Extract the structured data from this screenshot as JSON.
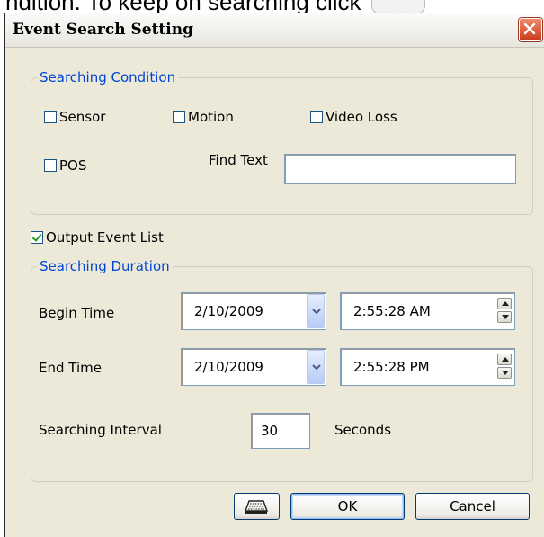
{
  "background_text": {
    "line": "ndition. To keep on searching click"
  },
  "dialog": {
    "title": "Event Search Setting"
  },
  "searching_condition": {
    "legend": "Searching Condition",
    "sensor": {
      "label": "Sensor",
      "checked": false
    },
    "motion": {
      "label": "Motion",
      "checked": false
    },
    "video_loss": {
      "label": "Video Loss",
      "checked": false
    },
    "pos": {
      "label": "POS",
      "checked": false
    },
    "find_text": {
      "label": "Find Text",
      "value": ""
    }
  },
  "output_event_list": {
    "label": "Output Event List",
    "checked": true
  },
  "searching_duration": {
    "legend": "Searching Duration",
    "begin": {
      "label": "Begin Time",
      "date": "2/10/2009",
      "time": "2:55:28 AM"
    },
    "end": {
      "label": "End Time",
      "date": "2/10/2009",
      "time": "2:55:28 PM"
    },
    "interval": {
      "label": "Searching Interval",
      "value": "30",
      "unit": "Seconds"
    }
  },
  "buttons": {
    "ok": "OK",
    "cancel": "Cancel"
  },
  "colors": {
    "legend": "#0046d5",
    "dialog_bg": "#ece9d8",
    "check_mark": "#21a121",
    "close_button": "#c93a1c"
  },
  "icons": {
    "close": "close-icon",
    "keyboard": "keyboard-icon",
    "dropdown": "chevron-down-icon",
    "spin_up": "spin-up-icon",
    "spin_down": "spin-down-icon"
  }
}
